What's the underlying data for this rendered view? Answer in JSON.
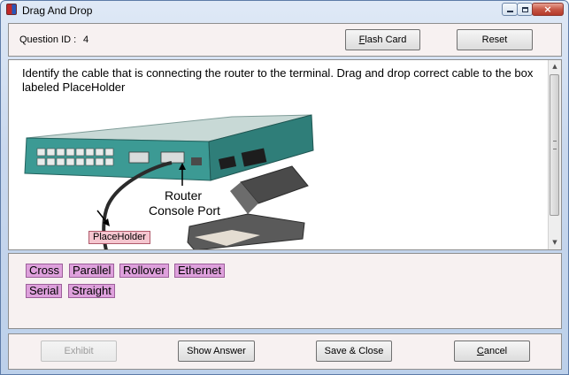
{
  "window": {
    "title": "Drag And Drop",
    "controls": {
      "minimize": "minimize",
      "maximize": "maximize",
      "close": "×"
    }
  },
  "header": {
    "question_id_label": "Question ID :",
    "question_id_value": "4",
    "flash_card_label": "Flash Card",
    "reset_label": "Reset"
  },
  "question": {
    "text": "Identify the cable that is connecting the router to the terminal. Drag and drop correct cable to the box labeled PlaceHolder",
    "image": {
      "router_label_line1": "Router",
      "router_label_line2": "Console Port"
    },
    "placeholder_label": "PlaceHolder",
    "scroll": {
      "up": "▲",
      "down": "▼"
    }
  },
  "options": [
    "Cross",
    "Parallel",
    "Rollover",
    "Ethernet",
    "Serial",
    "Straight"
  ],
  "footer": {
    "exhibit_label": "Exhibit",
    "show_answer_label": "Show Answer",
    "save_close_label": "Save & Close",
    "cancel_label": "Cancel"
  },
  "colors": {
    "option_chip": "#dea0dc",
    "placeholder": "#f5c6cf",
    "router_body": "#3c9a94",
    "panel_background": "#f7f1f1"
  }
}
